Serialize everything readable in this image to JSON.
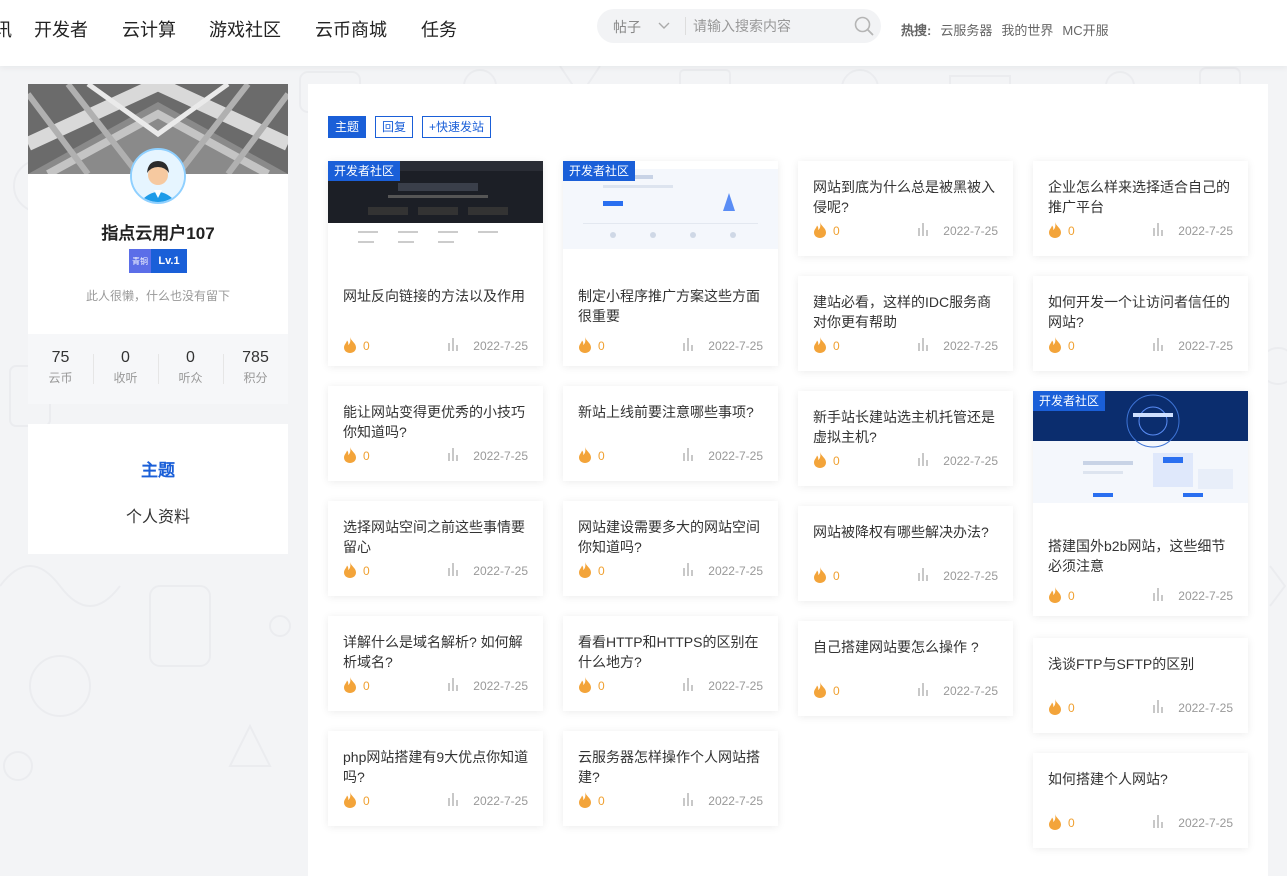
{
  "nav": {
    "cut_item": "讯",
    "items": [
      "开发者",
      "云计算",
      "游戏社区",
      "云币商城",
      "任务"
    ]
  },
  "search": {
    "type": "帖子",
    "placeholder": "请输入搜索内容"
  },
  "hot": {
    "label": "热搜:",
    "items": [
      "云服务器",
      "我的世界",
      "MC开服"
    ]
  },
  "profile": {
    "name": "指点云用户107",
    "badge_small": "青铜",
    "level": "Lv.1",
    "bio": "此人很懒，什么也没有留下",
    "stats": [
      {
        "value": "75",
        "label": "云币"
      },
      {
        "value": "0",
        "label": "收听"
      },
      {
        "value": "0",
        "label": "听众"
      },
      {
        "value": "785",
        "label": "积分"
      }
    ]
  },
  "menu": {
    "active": "主题",
    "other": "个人资料"
  },
  "tabs": [
    "主题",
    "回复",
    "+快速发站"
  ],
  "tag_label": "开发者社区",
  "posts": [
    {
      "title": "网址反向链接的方法以及作用",
      "fire": "0",
      "date": "2022-7-25"
    },
    {
      "title": "制定小程序推广方案这些方面很重要",
      "fire": "0",
      "date": "2022-7-25"
    },
    {
      "title": "网站到底为什么总是被黑被入侵呢?",
      "fire": "0",
      "date": "2022-7-25"
    },
    {
      "title": "企业怎么样来选择适合自己的推广平台",
      "fire": "0",
      "date": "2022-7-25"
    },
    {
      "title": "建站必看，这样的IDC服务商对你更有帮助",
      "fire": "0",
      "date": "2022-7-25"
    },
    {
      "title": "如何开发一个让访问者信任的网站?",
      "fire": "0",
      "date": "2022-7-25"
    },
    {
      "title": "能让网站变得更优秀的小技巧你知道吗?",
      "fire": "0",
      "date": "2022-7-25"
    },
    {
      "title": "新站上线前要注意哪些事项?",
      "fire": "0",
      "date": "2022-7-25"
    },
    {
      "title": "新手站长建站选主机托管还是虚拟主机?",
      "fire": "0",
      "date": "2022-7-25"
    },
    {
      "title": "搭建国外b2b网站，这些细节必须注意",
      "fire": "0",
      "date": "2022-7-25"
    },
    {
      "title": "选择网站空间之前这些事情要留心",
      "fire": "0",
      "date": "2022-7-25"
    },
    {
      "title": "网站建设需要多大的网站空间你知道吗?",
      "fire": "0",
      "date": "2022-7-25"
    },
    {
      "title": "网站被降权有哪些解决办法?",
      "fire": "0",
      "date": "2022-7-25"
    },
    {
      "title": "详解什么是域名解析? 如何解析域名?",
      "fire": "0",
      "date": "2022-7-25"
    },
    {
      "title": "看看HTTP和HTTPS的区别在什么地方?",
      "fire": "0",
      "date": "2022-7-25"
    },
    {
      "title": "自己搭建网站要怎么操作 ?",
      "fire": "0",
      "date": "2022-7-25"
    },
    {
      "title": "浅谈FTP与SFTP的区别",
      "fire": "0",
      "date": "2022-7-25"
    },
    {
      "title": "php网站搭建有9大优点你知道吗?",
      "fire": "0",
      "date": "2022-7-25"
    },
    {
      "title": "云服务器怎样操作个人网站搭建?",
      "fire": "0",
      "date": "2022-7-25"
    },
    {
      "title": "如何搭建个人网站?",
      "fire": "0",
      "date": "2022-7-25"
    }
  ]
}
